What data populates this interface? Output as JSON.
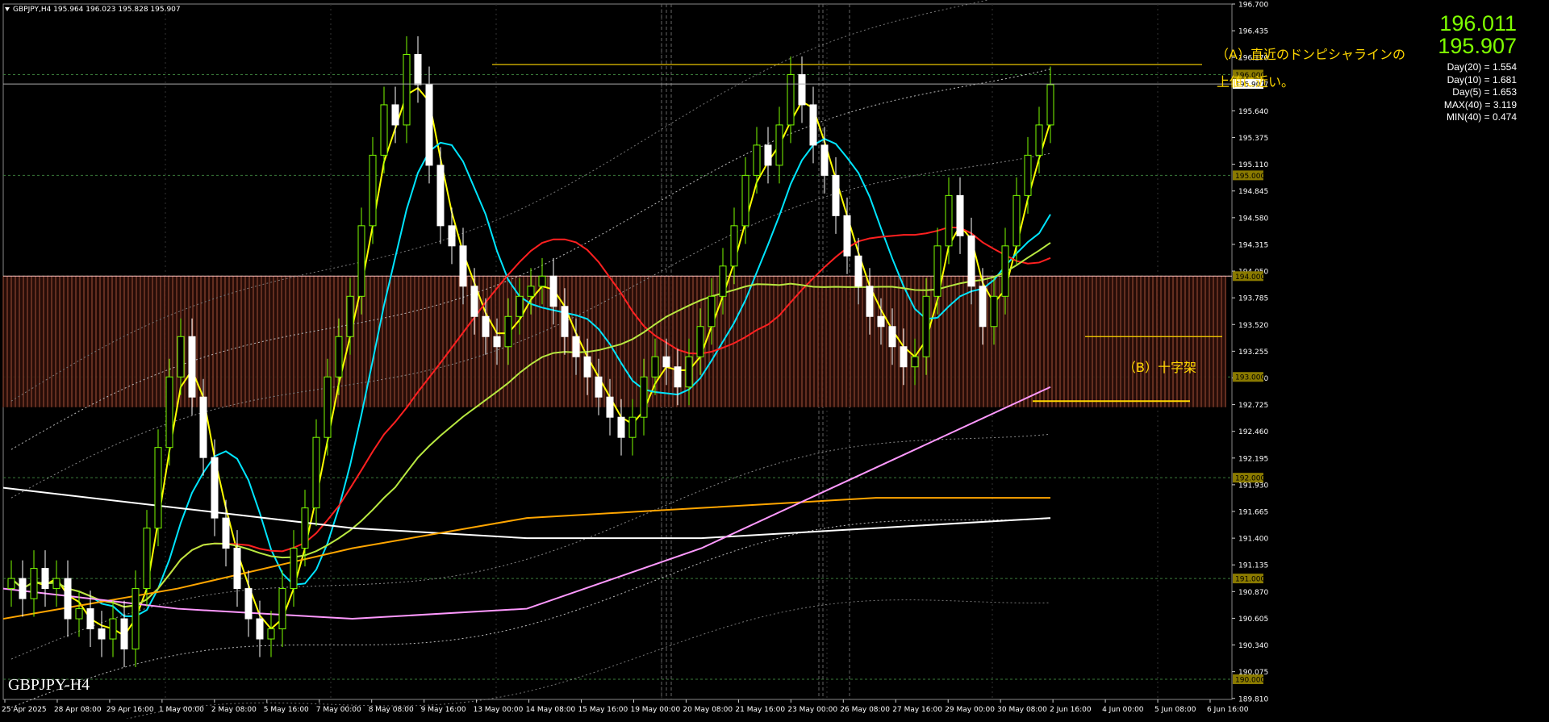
{
  "header": {
    "info": "GBPJPY,H4  195.964 196.023 195.828 195.907",
    "price_top": "196.011",
    "price_bottom": "195.907"
  },
  "stats": [
    "Day(20) = 1.554",
    "Day(10) = 1.681",
    "Day(5) = 1.653",
    "MAX(40) = 3.119",
    "MIN(40) = 0.474"
  ],
  "annotations": {
    "a_line1": "（A）直近のドンピシャラインの",
    "a_line2": "上値に近い。",
    "b": "（B）十字架"
  },
  "symbol_label": "GBPJPY-H4",
  "colors": {
    "bull": "#7CFC00",
    "bear": "#ffffff",
    "grid": "#3a7a3a",
    "cloud": "#a0503a",
    "sma_fast": "#ffff00",
    "sma_mid": "#00e5ff",
    "sma_slow": "#ff2020",
    "sma_yellowgreen": "#b8e840",
    "sma_orange": "#ffa500",
    "sma_white": "#ffffff",
    "sma_pink": "#ff99ff",
    "donchian": "#ffd700"
  },
  "chart_data": {
    "type": "candlestick",
    "symbol": "GBPJPY",
    "timeframe": "H4",
    "ylim": [
      189.8,
      196.7
    ],
    "y_ticks": [
      "196.700",
      "196.435",
      "196.170",
      "195.907",
      "195.640",
      "195.375",
      "195.110",
      "194.845",
      "194.580",
      "194.315",
      "194.050",
      "193.785",
      "193.520",
      "193.255",
      "192.990",
      "192.725",
      "192.460",
      "192.195",
      "191.930",
      "191.665",
      "191.400",
      "191.135",
      "190.870",
      "190.605",
      "190.340",
      "190.075",
      "189.810"
    ],
    "highlighted_ticks": [
      {
        "label": "196.000",
        "value": 196.0
      },
      {
        "label": "195.000",
        "value": 195.0
      },
      {
        "label": "194.000",
        "value": 194.0
      },
      {
        "label": "193.000",
        "value": 193.0
      },
      {
        "label": "192.000",
        "value": 192.0
      },
      {
        "label": "191.000",
        "value": 191.0
      },
      {
        "label": "190.000",
        "value": 190.0
      }
    ],
    "current_price": {
      "label": "195.907",
      "value": 195.907
    },
    "x_labels": [
      "25 Apr 2025",
      "28 Apr 08:00",
      "29 Apr 16:00",
      "1 May 00:00",
      "2 May 08:00",
      "5 May 16:00",
      "7 May 00:00",
      "8 May 08:00",
      "9 May 16:00",
      "13 May 00:00",
      "14 May 08:00",
      "15 May 16:00",
      "19 May 00:00",
      "20 May 08:00",
      "21 May 16:00",
      "23 May 00:00",
      "26 May 08:00",
      "27 May 16:00",
      "29 May 00:00",
      "30 May 08:00",
      "2 Jun 16:00",
      "4 Jun 00:00",
      "5 Jun 08:00",
      "6 Jun 16:00"
    ],
    "closes": [
      191.0,
      190.8,
      191.1,
      190.9,
      191.0,
      190.6,
      190.7,
      190.5,
      190.4,
      190.6,
      190.3,
      190.9,
      191.5,
      192.3,
      193.0,
      193.4,
      192.8,
      192.2,
      191.6,
      191.3,
      190.9,
      190.6,
      190.4,
      190.5,
      190.9,
      191.3,
      191.7,
      192.4,
      193.0,
      193.4,
      193.8,
      194.5,
      195.2,
      195.7,
      195.5,
      196.2,
      195.9,
      195.1,
      194.5,
      194.3,
      193.9,
      193.6,
      193.4,
      193.3,
      193.6,
      193.8,
      193.9,
      194.0,
      193.7,
      193.4,
      193.2,
      193.0,
      192.8,
      192.6,
      192.4,
      192.6,
      193.0,
      193.2,
      193.1,
      192.9,
      193.2,
      193.5,
      193.8,
      194.1,
      194.5,
      195.0,
      195.3,
      195.1,
      195.5,
      196.0,
      195.7,
      195.3,
      195.0,
      194.6,
      194.2,
      193.9,
      193.6,
      193.5,
      193.3,
      193.1,
      193.2,
      193.8,
      194.3,
      194.8,
      194.4,
      193.9,
      193.5,
      193.8,
      194.3,
      194.8,
      195.2,
      195.5,
      195.9
    ],
    "donchian_upper": 196.1,
    "cross_low": 193.4,
    "cross_floor": 192.76,
    "cloud_top": 194.0,
    "cloud_bottom": 192.7,
    "annotations": [
      "（A）直近のドンピシャラインの上値に近い。",
      "（B）十字架"
    ]
  }
}
